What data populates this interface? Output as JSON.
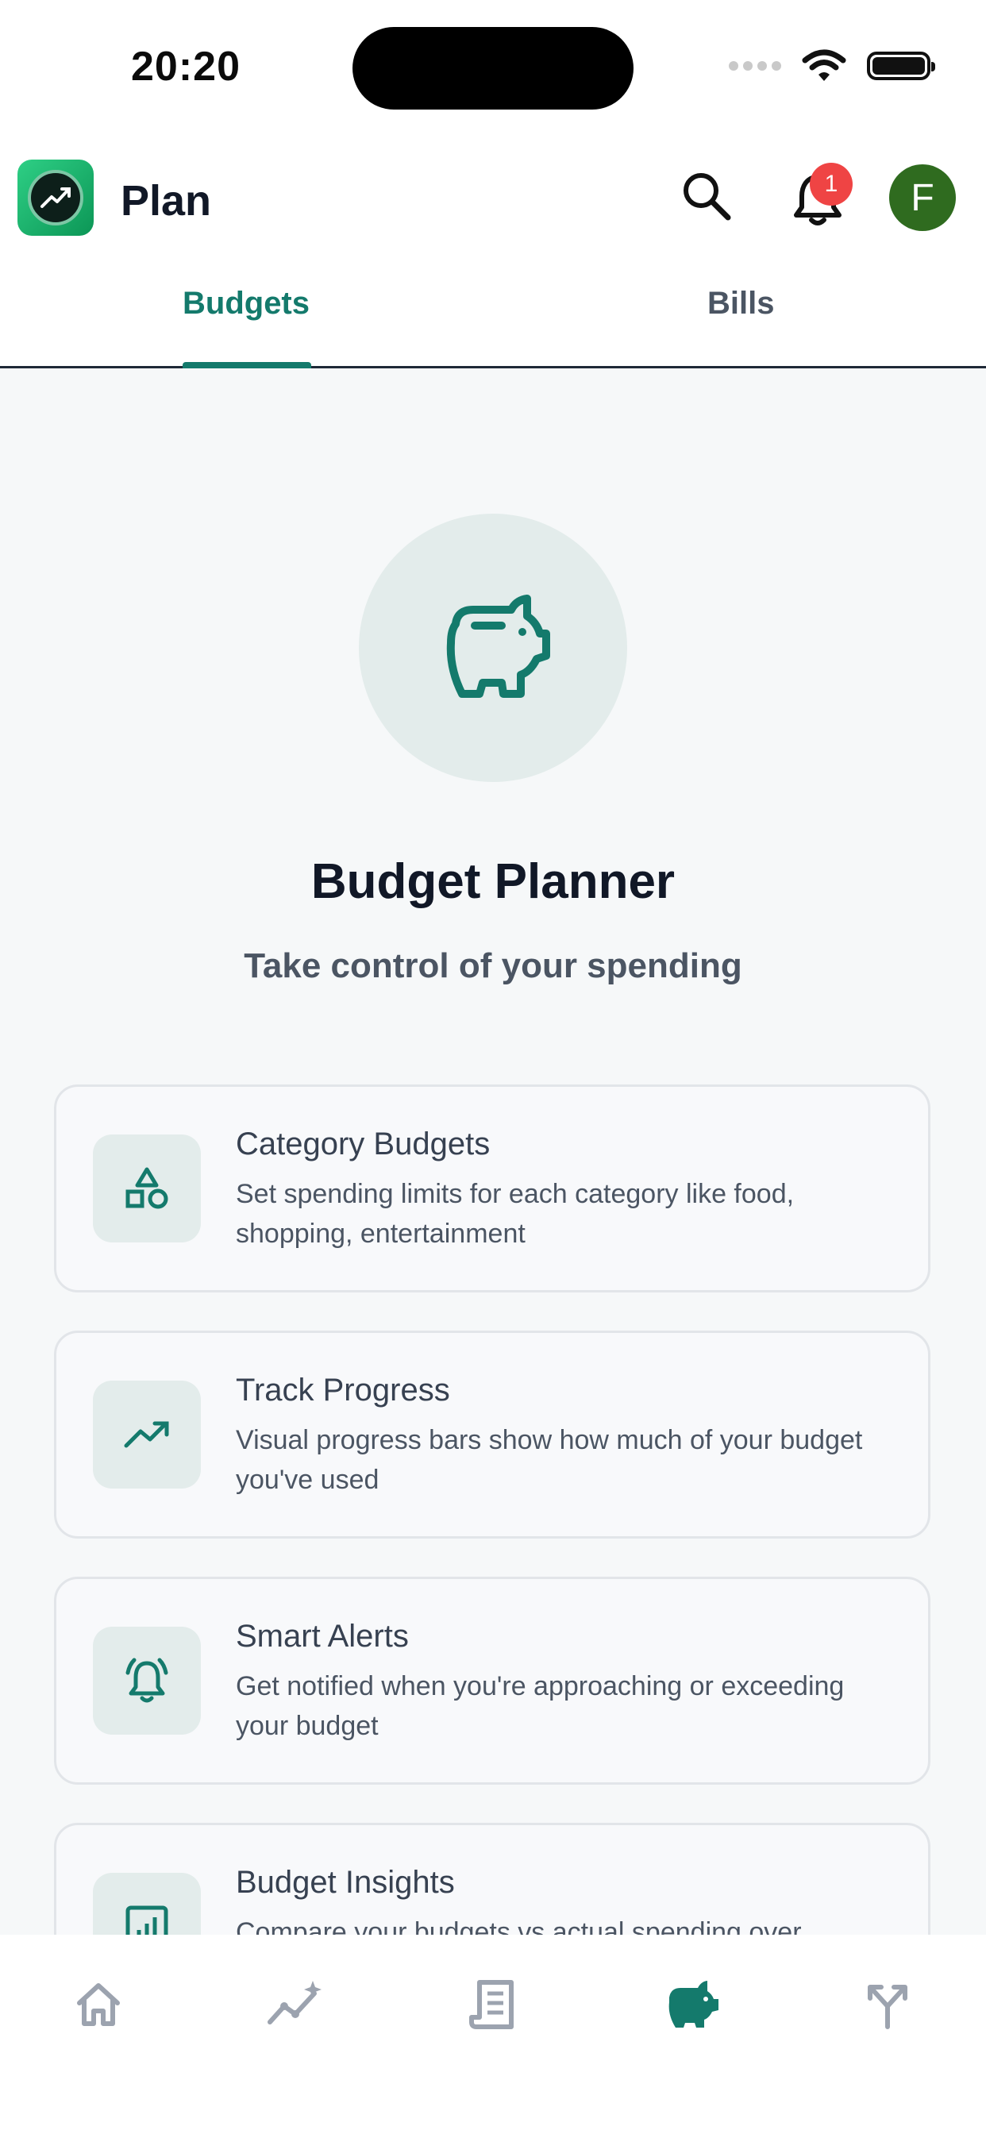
{
  "status_bar": {
    "time": "20:20"
  },
  "header": {
    "app_title": "Plan",
    "notification_count": "1",
    "avatar_initial": "F"
  },
  "tabs": [
    {
      "label": "Budgets",
      "active": true
    },
    {
      "label": "Bills",
      "active": false
    }
  ],
  "hero": {
    "icon": "piggy-bank-icon",
    "title": "Budget Planner",
    "subtitle": "Take control of your spending"
  },
  "features": [
    {
      "icon": "shapes-icon",
      "title": "Category Budgets",
      "description": "Set spending limits for each category like food, shopping, entertainment"
    },
    {
      "icon": "trending-up-icon",
      "title": "Track Progress",
      "description": "Visual progress bars show how much of your budget you've used"
    },
    {
      "icon": "bell-ring-icon",
      "title": "Smart Alerts",
      "description": "Get notified when you're approaching or exceeding your budget"
    },
    {
      "icon": "bar-chart-icon",
      "title": "Budget Insights",
      "description": "Compare your budgets vs actual spending over"
    }
  ],
  "bottom_nav": [
    {
      "icon": "home-icon",
      "active": false
    },
    {
      "icon": "sparkle-chart-icon",
      "active": false
    },
    {
      "icon": "receipt-icon",
      "active": false
    },
    {
      "icon": "piggy-bank-icon",
      "active": true
    },
    {
      "icon": "split-arrows-icon",
      "active": false
    }
  ],
  "colors": {
    "accent": "#147a6c",
    "badge": "#ef4444",
    "avatar": "#2f6b1f",
    "inactive": "#9ca3af"
  }
}
